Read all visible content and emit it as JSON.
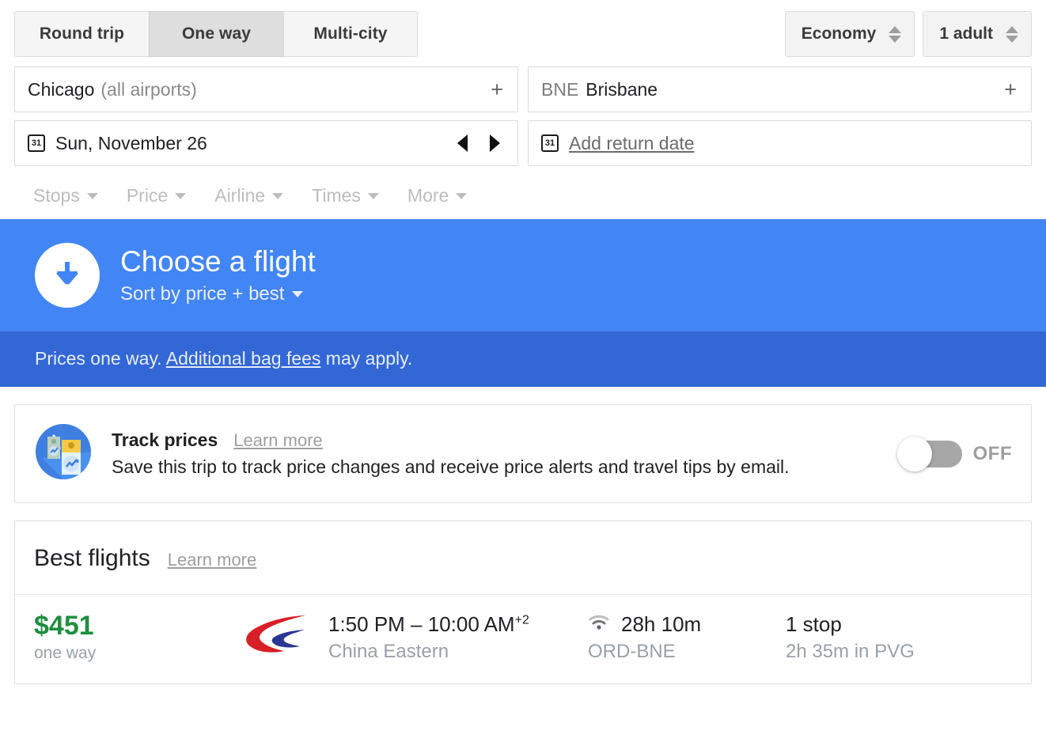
{
  "trip_types": [
    {
      "label": "Round trip",
      "selected": false
    },
    {
      "label": "One way",
      "selected": true
    },
    {
      "label": "Multi-city",
      "selected": false
    }
  ],
  "passengers": {
    "cabin_class": "Economy",
    "traveler_count": "1 adult"
  },
  "search": {
    "origin_city": "Chicago",
    "origin_qualifier": "(all airports)",
    "destination_code": "BNE",
    "destination_city": "Brisbane",
    "add_origin_label": "+",
    "add_destination_label": "+",
    "depart_date": "Sun, November 26",
    "return_date_placeholder": "Add return date",
    "calendar_glyph": "31"
  },
  "filters": [
    {
      "label": "Stops"
    },
    {
      "label": "Price"
    },
    {
      "label": "Airline"
    },
    {
      "label": "Times"
    },
    {
      "label": "More"
    }
  ],
  "banner": {
    "heading": "Choose a flight",
    "sort_label": "Sort by price + best",
    "notice_prefix": "Prices one way. ",
    "notice_link": "Additional bag fees",
    "notice_suffix": " may apply.",
    "color_top": "#4285F4",
    "color_bottom": "#3367D6"
  },
  "track_prices": {
    "title": "Track prices",
    "learn_more": "Learn more",
    "description": "Save this trip to track price changes and receive price alerts and travel tips by email.",
    "toggle_state": "OFF"
  },
  "best_flights": {
    "title": "Best flights",
    "learn_more": "Learn more",
    "results": [
      {
        "price": "$451",
        "price_note": "one way",
        "times": "1:50 PM – 10:00 AM",
        "day_offset": "+2",
        "airline": "China Eastern",
        "duration": "28h 10m",
        "route": "ORD-BNE",
        "stops": "1 stop",
        "layover": "2h 35m in PVG"
      }
    ]
  },
  "colors": {
    "price_green": "#1E8E3E",
    "selected_tab_bg": "#DEDEDE",
    "muted_gray": "#9AA0A6"
  }
}
